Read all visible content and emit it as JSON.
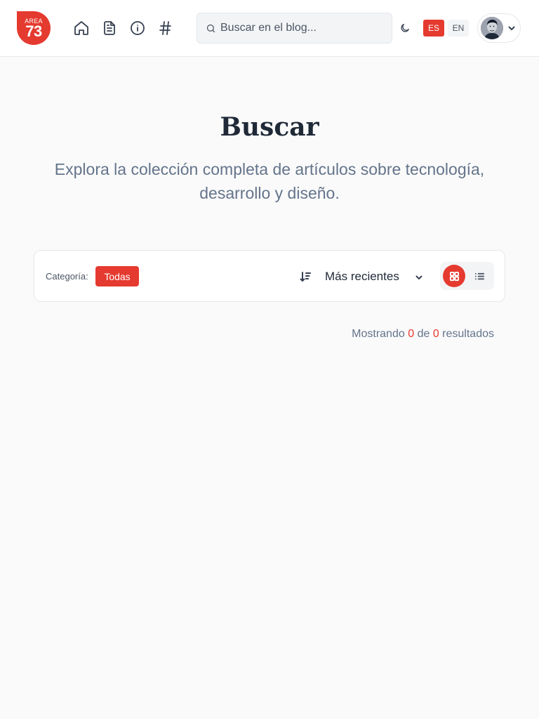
{
  "header": {
    "logo": {
      "line1": "AREA",
      "line2": "73"
    },
    "nav": [
      {
        "name": "home-icon"
      },
      {
        "name": "document-icon"
      },
      {
        "name": "info-icon"
      },
      {
        "name": "hash-icon"
      }
    ],
    "search": {
      "placeholder": "Buscar en el blog...",
      "value": ""
    },
    "theme_icon": "moon-icon",
    "languages": [
      {
        "code": "ES",
        "active": true
      },
      {
        "code": "EN",
        "active": false
      }
    ]
  },
  "hero": {
    "title": "Buscar",
    "subtitle": "Explora la colección completa de artículos sobre tecnología, desarrollo y diseño."
  },
  "filters": {
    "category_label": "Categoría:",
    "category_selected": "Todas",
    "sort_selected": "Más recientes",
    "view_mode": "grid"
  },
  "results": {
    "prefix": "Mostrando",
    "shown": "0",
    "of": "de",
    "total": "0",
    "suffix": "resultados"
  },
  "colors": {
    "accent": "#e53a2f",
    "background": "#fafafa",
    "muted_text": "#64748b"
  }
}
